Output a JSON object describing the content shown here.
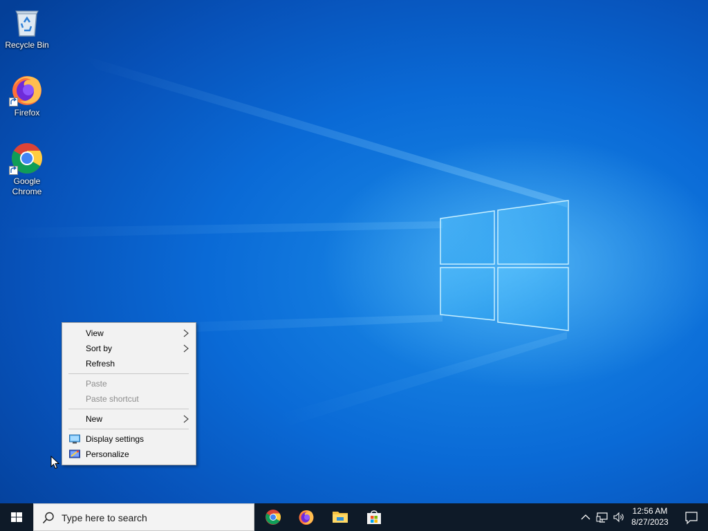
{
  "desktop": {
    "icons": [
      {
        "label": "Recycle Bin",
        "icon": "recycle-bin-icon"
      },
      {
        "label": "Firefox",
        "icon": "firefox-icon"
      },
      {
        "label": "Google Chrome",
        "icon": "chrome-icon"
      }
    ]
  },
  "context_menu": {
    "items": [
      {
        "label": "View",
        "submenu": true,
        "enabled": true
      },
      {
        "label": "Sort by",
        "submenu": true,
        "enabled": true
      },
      {
        "label": "Refresh",
        "submenu": false,
        "enabled": true
      },
      {
        "label": "Paste",
        "submenu": false,
        "enabled": false
      },
      {
        "label": "Paste shortcut",
        "submenu": false,
        "enabled": false
      },
      {
        "label": "New",
        "submenu": true,
        "enabled": true
      },
      {
        "label": "Display settings",
        "submenu": false,
        "enabled": true,
        "icon": "display-icon"
      },
      {
        "label": "Personalize",
        "submenu": false,
        "enabled": true,
        "icon": "personalize-icon"
      }
    ]
  },
  "taskbar": {
    "search_placeholder": "Type here to search",
    "pinned_apps": [
      "chrome-icon",
      "firefox-icon",
      "file-explorer-icon",
      "microsoft-store-icon"
    ],
    "tray_icons": [
      "chevron-up-icon",
      "network-icon",
      "volume-icon"
    ],
    "clock": {
      "time": "12:56 AM",
      "date": "8/27/2023"
    },
    "notification_icon": "action-center-icon"
  },
  "colors": {
    "desktop_blue": "#0a63c9",
    "taskbar": "#0e1a28",
    "menu_bg": "#f2f2f2"
  }
}
